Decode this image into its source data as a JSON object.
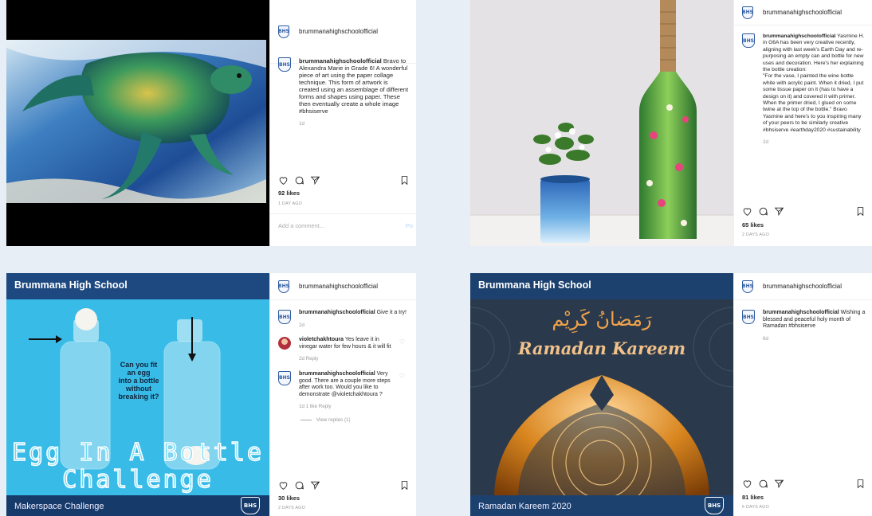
{
  "brand": {
    "logo_text": "BHS",
    "accent": "#1d4980"
  },
  "posts": [
    {
      "username": "brummanahighschoolofficial",
      "caption": "Bravo to Alexandra Marie in Grade 6! A wonderful piece of art using the paper collage technique. This form of artwork is created using an assemblage of different forms and shapes using paper. These then eventually create a whole image #bhsiserve",
      "time": "1d",
      "likes": "92 likes",
      "ago": "1 DAY AGO",
      "add_comment": "Add a comment...",
      "post_label": "Po",
      "image": "sea-turtle-collage"
    },
    {
      "username": "brummanahighschoolofficial",
      "caption": "Yasmine H. in G6A has been very creative recently, aligning with last week's Earth Day and re-purposing an empty can and bottle for new uses and decoration. Here's her explaining the bottle creation:\n\"For the vase, I painted the wine bottle white with acrylic paint. When it dried, I put some tissue paper on it (has to have a design on it) and covered it with primer. When the primer dried, I glued on some twine at the top of the bottle.\" Bravo Yasmine and here's to you inspiring many of your peers to be similarly creative #bhsiserve #earthday2020 #sustainability",
      "time": "2d",
      "likes": "65 likes",
      "ago": "2 DAYS AGO",
      "image": "decorated-bottle-and-can"
    },
    {
      "username": "brummanahighschoolofficial",
      "banner": "Brummana High School",
      "footer": "Makerspace Challenge",
      "question": "Can you fit\nan egg\ninto a bottle\nwithout\nbreaking it?",
      "big_title_1": "Egg In A Bottle",
      "big_title_2": "Challenge",
      "caption": "Give it a try!",
      "time": "2d",
      "comments": [
        {
          "user": "violetchakhtoura",
          "text": "Yes leave it in vinegar water for few hours & it will fit",
          "meta": "2d   Reply"
        },
        {
          "user": "brummanahighschoolofficial",
          "text": "Very good. There are a couple more steps after work too. Would you like to demonstrate @violetchakhtoura ?",
          "meta": "1d   1 like   Reply"
        }
      ],
      "view_replies": "View replies (1)",
      "likes": "30 likes",
      "ago": "2 DAYS AGO"
    },
    {
      "username": "brummanahighschoolofficial",
      "banner": "Brummana High School",
      "footer": "Ramadan Kareem 2020",
      "arabic": "رَمَضانُ كَرِيْم",
      "latin": "Ramadan Kareem",
      "caption": "Wishing a blessed and peaceful holy month of Ramadan #bhsiserve",
      "time": "6d",
      "likes": "81 likes",
      "ago": "6 DAYS AGO"
    }
  ]
}
